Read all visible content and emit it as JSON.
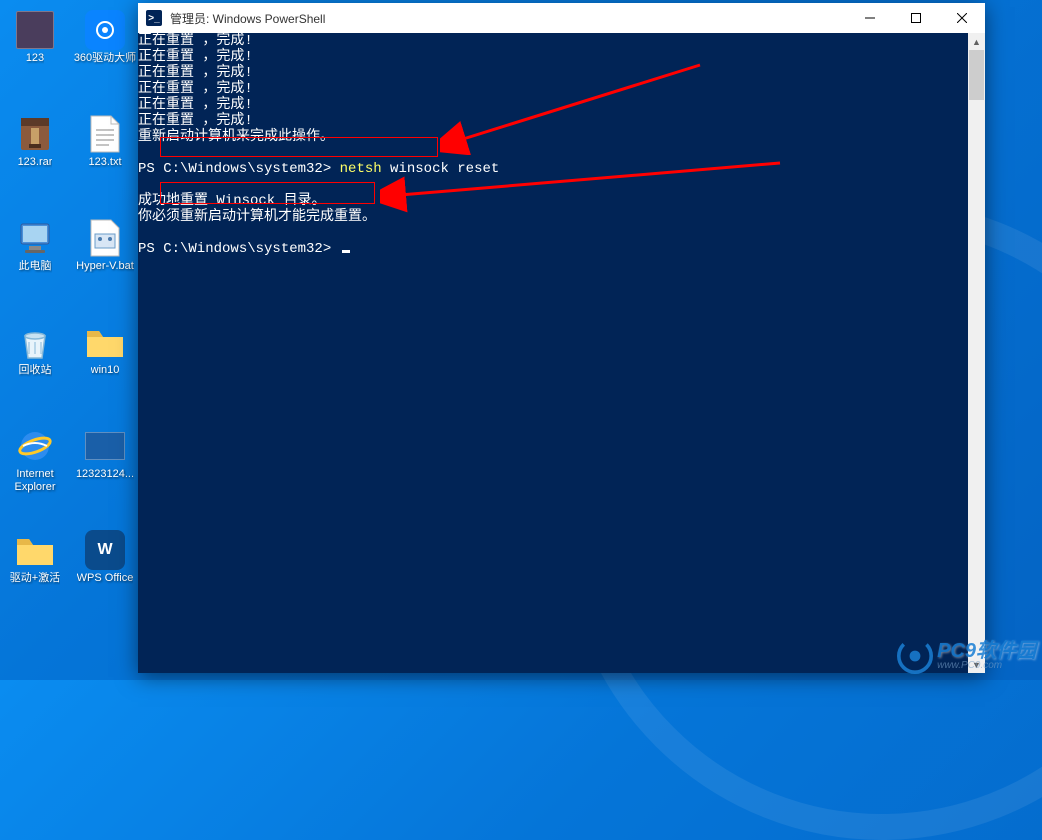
{
  "desktop": {
    "icons": [
      [
        {
          "label": "123",
          "type": "image",
          "bg": "#4a3d5c"
        },
        {
          "label": "360驱动大师",
          "type": "app",
          "bg": "#0a84ff"
        }
      ],
      [
        {
          "label": "123.rar",
          "type": "rar",
          "bg": "#8b5a3c"
        },
        {
          "label": "123.txt",
          "type": "txt",
          "bg": "#fff"
        }
      ],
      [
        {
          "label": "此电脑",
          "type": "computer",
          "bg": "transparent"
        },
        {
          "label": "Hyper-V.bat",
          "type": "bat",
          "bg": "#fff"
        }
      ],
      [
        {
          "label": "回收站",
          "type": "recycle",
          "bg": "transparent"
        },
        {
          "label": "win10",
          "type": "folder",
          "bg": "#ffd86b"
        }
      ],
      [
        {
          "label": "Internet Explorer",
          "type": "ie",
          "bg": "transparent",
          "multiline": true
        },
        {
          "label": "12323124...",
          "type": "imgfile",
          "bg": "#1a5fa8"
        }
      ],
      [
        {
          "label": "驱动+激活",
          "type": "folder",
          "bg": "#ffd86b"
        },
        {
          "label": "WPS Office",
          "type": "wps",
          "bg": "#0a4b8c"
        }
      ]
    ]
  },
  "window": {
    "title": "管理员: Windows PowerShell",
    "lines": {
      "reset_line": "正在重置 ，完成!",
      "restart_msg": "重新启动计算机来完成此操作。",
      "prompt1_prefix": "PS C:\\Windows\\system32> ",
      "cmd_netsh": "netsh",
      "cmd_rest": " winsock reset",
      "result1": "成功地重置 Winsock 目录。",
      "result2": "你必须重新启动计算机才能完成重置。",
      "prompt2": "PS C:\\Windows\\system32> "
    }
  },
  "watermark": {
    "main": "PC9软件园",
    "sub": "www.PC9.com"
  }
}
